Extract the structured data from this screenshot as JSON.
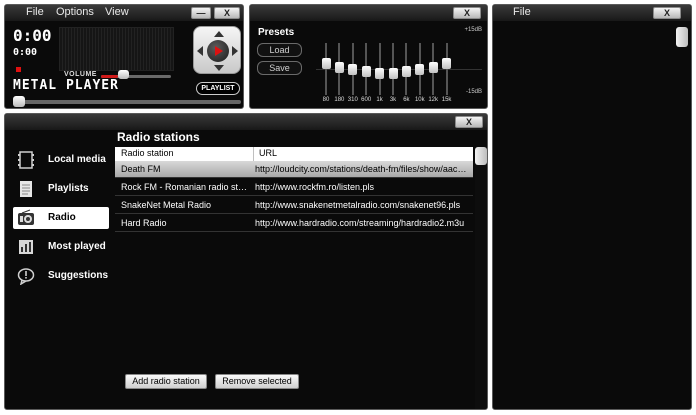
{
  "player": {
    "menu": [
      "File",
      "Options",
      "View"
    ],
    "minimize_label": "—",
    "close_label": "X",
    "time_display": "0:00",
    "small_time": "0:00",
    "volume_label": "VOLUME",
    "volume_level_percent": 55,
    "seek_position_percent": 0,
    "name": "METAL PLAYER",
    "playlist_button": "PLAYLIST"
  },
  "equalizer": {
    "close_label": "X",
    "presets_label": "Presets",
    "load_label": "Load",
    "save_label": "Save",
    "db_top": "+15dB",
    "db_bottom": "-15dB",
    "bands": [
      {
        "freq": "80",
        "level": 3
      },
      {
        "freq": "180",
        "level": 1
      },
      {
        "freq": "310",
        "level": 0
      },
      {
        "freq": "600",
        "level": -1
      },
      {
        "freq": "1k",
        "level": -2
      },
      {
        "freq": "3k",
        "level": -2
      },
      {
        "freq": "6k",
        "level": -1
      },
      {
        "freq": "10k",
        "level": 0
      },
      {
        "freq": "12k",
        "level": 1
      },
      {
        "freq": "15k",
        "level": 3
      }
    ]
  },
  "library": {
    "close_label": "X",
    "sidebar": [
      {
        "label": "Local media",
        "icon": "film-icon",
        "active": false
      },
      {
        "label": "Playlists",
        "icon": "document-icon",
        "active": false
      },
      {
        "label": "Radio",
        "icon": "radio-icon",
        "active": true
      },
      {
        "label": "Most played",
        "icon": "chart-icon",
        "active": false
      },
      {
        "label": "Suggestions",
        "icon": "speech-bubble-icon",
        "active": false
      }
    ],
    "section_title": "Radio stations",
    "columns": [
      "Radio station",
      "URL"
    ],
    "rows": [
      {
        "station": "Death FM",
        "url": "http://loudcity.com/stations/death-fm/files/show/aacplus",
        "selected": true
      },
      {
        "station": "Rock FM - Romanian radio stati...",
        "url": "http://www.rockfm.ro/listen.pls",
        "selected": false
      },
      {
        "station": "SnakeNet Metal Radio",
        "url": "http://www.snakenetmetalradio.com/snakenet96.pls",
        "selected": false
      },
      {
        "station": "Hard Radio",
        "url": "http://www.hardradio.com/streaming/hardradio2.m3u",
        "selected": false
      }
    ],
    "add_button": "Add radio station",
    "remove_button": "Remove selected"
  },
  "file_panel": {
    "title": "File",
    "close_label": "X"
  },
  "colors": {
    "accent": "#d01a1a",
    "background": "#0a0a0a",
    "selected_row": "#c0c0c0"
  }
}
